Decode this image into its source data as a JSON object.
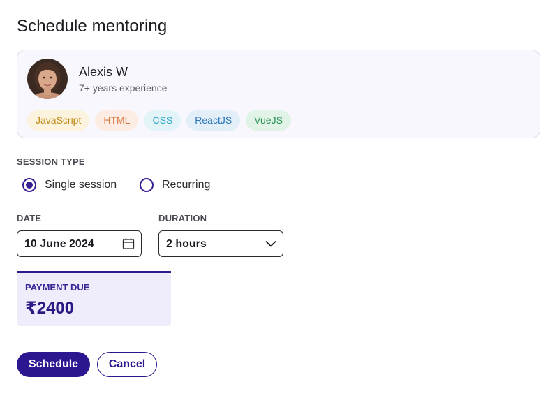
{
  "page": {
    "title": "Schedule mentoring"
  },
  "mentor": {
    "name": "Alexis W",
    "experience": "7+ years experience",
    "tags": [
      {
        "label": "JavaScript",
        "bg": "#fbf3dd",
        "color": "#c08a16"
      },
      {
        "label": "HTML",
        "bg": "#fdece3",
        "color": "#d9773e"
      },
      {
        "label": "CSS",
        "bg": "#e3f4f9",
        "color": "#2ba7c8"
      },
      {
        "label": "ReactJS",
        "bg": "#e2eef8",
        "color": "#2a76b8"
      },
      {
        "label": "VueJS",
        "bg": "#e0f3e6",
        "color": "#259151"
      }
    ]
  },
  "session_type": {
    "label": "SESSION TYPE",
    "options": [
      {
        "label": "Single session",
        "checked": true
      },
      {
        "label": "Recurring",
        "checked": false
      }
    ]
  },
  "date": {
    "label": "DATE",
    "value": "10 June 2024",
    "icon": "calendar-icon"
  },
  "duration": {
    "label": "DURATION",
    "value": "2 hours",
    "icon": "chevron-down-icon"
  },
  "payment": {
    "label": "PAYMENT DUE",
    "amount": "₹2400"
  },
  "actions": {
    "schedule": "Schedule",
    "cancel": "Cancel"
  },
  "colors": {
    "primary": "#2d1690",
    "card_bg": "#f8f7fd",
    "payment_bg": "#efedfc"
  }
}
